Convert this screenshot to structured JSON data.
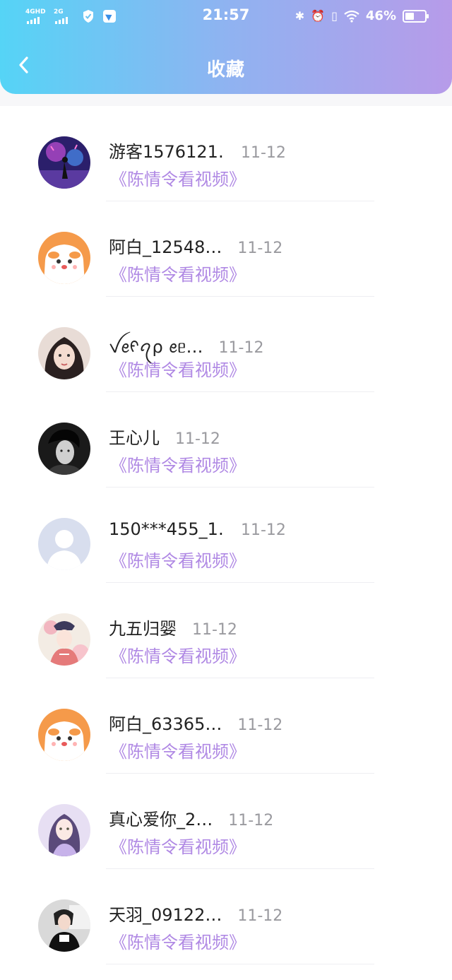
{
  "status_bar": {
    "network_1": "4GHD",
    "network_2": "2G",
    "time": "21:57",
    "battery_percent": "46%",
    "battery_level": 0.46
  },
  "header": {
    "title": "收藏",
    "gradient": [
      "#55d4f6",
      "#b79be9"
    ]
  },
  "accent_color": "#b089e4",
  "favorites": [
    {
      "name": "游客1576121…",
      "date": "11-12",
      "video": "《陈情令看视频》",
      "avatar": "neon-scene"
    },
    {
      "name": "阿白_12548…",
      "date": "11-12",
      "video": "《陈情令看视频》",
      "avatar": "cartoon-dog"
    },
    {
      "name": "ꪜꫀᠻꪖρ ꫀᥱ…",
      "date": "11-12",
      "video": "《陈情令看视频》",
      "avatar": "girl-photo"
    },
    {
      "name": "王心儿",
      "date": "11-12",
      "video": "《陈情令看视频》",
      "avatar": "bw-portrait"
    },
    {
      "name": "150***455_1…",
      "date": "11-12",
      "video": "《陈情令看视频》",
      "avatar": "default-person"
    },
    {
      "name": "九五归婴",
      "date": "11-12",
      "video": "《陈情令看视频》",
      "avatar": "opera-art"
    },
    {
      "name": "阿白_63365…",
      "date": "11-12",
      "video": "《陈情令看视频》",
      "avatar": "cartoon-dog"
    },
    {
      "name": "真心爱你_2…",
      "date": "11-12",
      "video": "《陈情令看视频》",
      "avatar": "anime-girl"
    },
    {
      "name": "天羽_09122…",
      "date": "11-12",
      "video": "《陈情令看视频》",
      "avatar": "street-photo"
    }
  ]
}
